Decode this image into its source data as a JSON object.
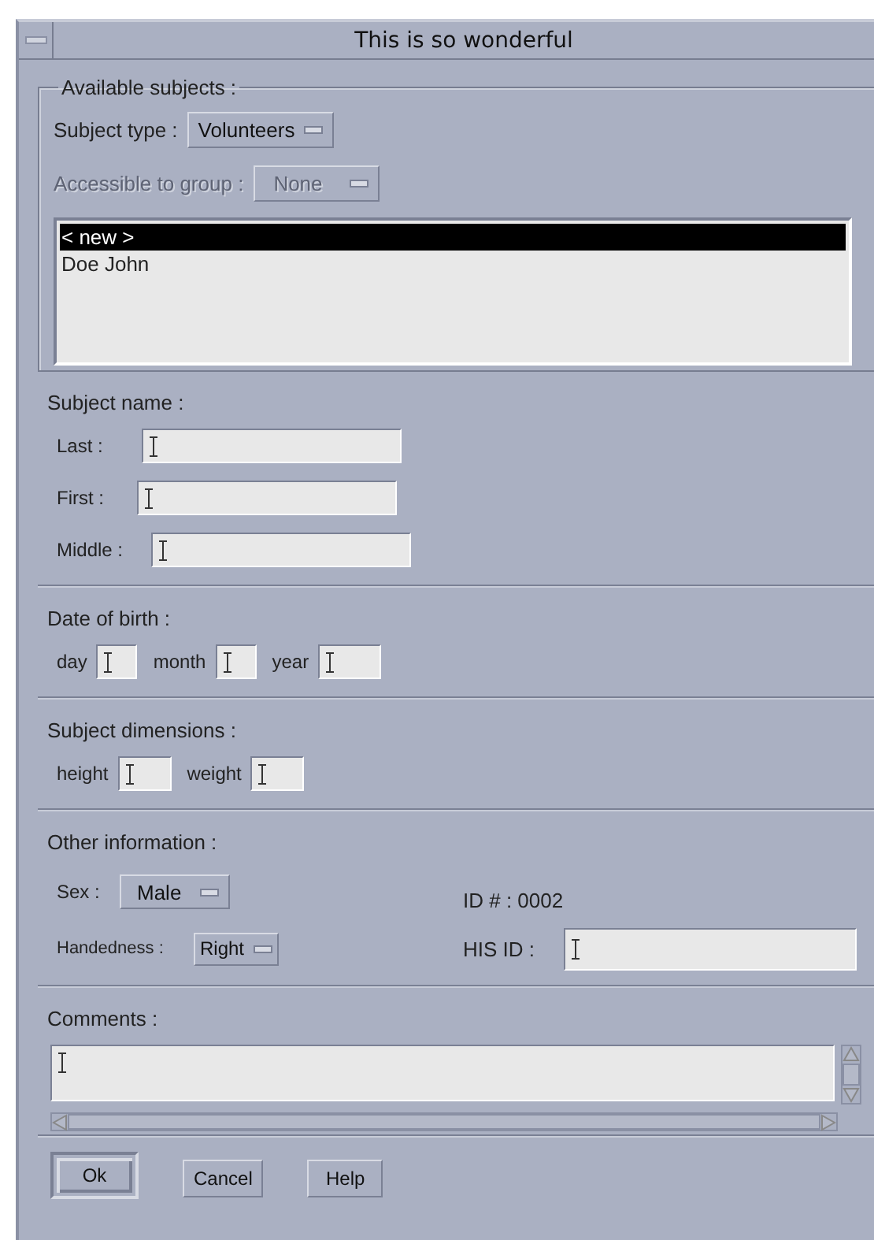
{
  "window": {
    "title": "This is so wonderful"
  },
  "available_subjects": {
    "title": "Available subjects :",
    "subject_type": {
      "label": "Subject type :",
      "value": "Volunteers",
      "disabled": false
    },
    "accessible_to_group": {
      "label": "Accessible to group :",
      "value": "None",
      "disabled": true
    },
    "items": [
      {
        "label": "< new >",
        "selected": true
      },
      {
        "label": "Doe John",
        "selected": false
      }
    ]
  },
  "subject_name": {
    "title": "Subject name :",
    "fields": [
      {
        "label": "Last  :"
      },
      {
        "label": "First  :"
      },
      {
        "label": "Middle :"
      }
    ]
  },
  "date_of_birth": {
    "title": "Date of birth :",
    "fields": [
      {
        "label": "day"
      },
      {
        "label": "month"
      },
      {
        "label": "year"
      }
    ]
  },
  "subject_dimensions": {
    "title": "Subject dimensions :",
    "fields": [
      {
        "label": "height"
      },
      {
        "label": "weight"
      }
    ]
  },
  "other_information": {
    "title": "Other information :",
    "sex": {
      "label": "Sex :",
      "value": "Male"
    },
    "handedness": {
      "label": "Handedness :",
      "value": "Right"
    },
    "id_text": "ID # : 0002",
    "his_id": {
      "label": "HIS ID :"
    }
  },
  "comments": {
    "title": "Comments :"
  },
  "buttons": [
    {
      "label": "Ok",
      "default": true
    },
    {
      "label": "Cancel",
      "default": false
    },
    {
      "label": "Help",
      "default": false
    }
  ]
}
